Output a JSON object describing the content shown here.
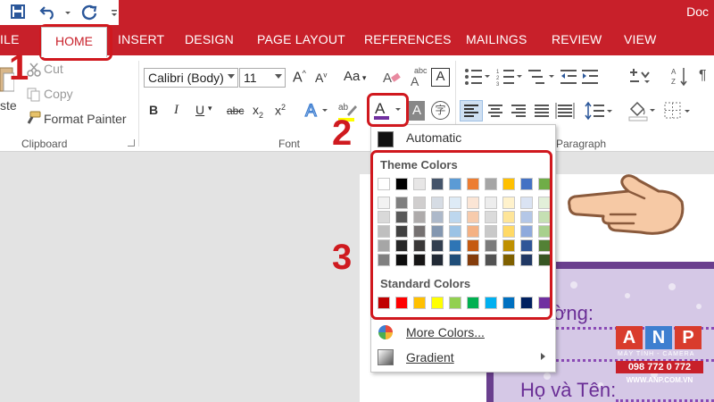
{
  "app": {
    "title": "Doc"
  },
  "qat": {
    "save_icon": "save-icon",
    "undo_icon": "undo-icon",
    "redo_icon": "redo-icon"
  },
  "tabs": {
    "file": "ILE",
    "home": "HOME",
    "insert": "INSERT",
    "design": "DESIGN",
    "page_layout": "PAGE LAYOUT",
    "references": "REFERENCES",
    "mailings": "MAILINGS",
    "review": "REVIEW",
    "view": "VIEW"
  },
  "clipboard": {
    "cut": "Cut",
    "copy": "Copy",
    "paste_fragment": "ste",
    "format_painter": "Format Painter",
    "group_label": "Clipboard"
  },
  "font": {
    "name": "Calibri (Body)",
    "size": "11",
    "case_label": "Aa",
    "group_label": "Font"
  },
  "paragraph": {
    "group_label": "Paragraph"
  },
  "menu": {
    "automatic": "Automatic",
    "theme_header": "Theme Colors",
    "standard_header": "Standard Colors",
    "more_colors": "More Colors...",
    "gradient": "Gradient"
  },
  "theme_colors": {
    "top": [
      "#ffffff",
      "#000000",
      "#e7e6e6",
      "#44546a",
      "#5b9bd5",
      "#ed7d31",
      "#a5a5a5",
      "#ffc000",
      "#4472c4",
      "#70ad47"
    ],
    "shades": [
      [
        "#f2f2f2",
        "#d9d9d9",
        "#bfbfbf",
        "#a6a6a6",
        "#808080"
      ],
      [
        "#7f7f7f",
        "#595959",
        "#404040",
        "#262626",
        "#0d0d0d"
      ],
      [
        "#d0cece",
        "#aeabab",
        "#757171",
        "#3a3838",
        "#171616"
      ],
      [
        "#d6dce4",
        "#adb9ca",
        "#8497b0",
        "#333f50",
        "#222a35"
      ],
      [
        "#deebf6",
        "#bdd7ee",
        "#9cc3e5",
        "#2e75b5",
        "#1f4e79"
      ],
      [
        "#fbe5d5",
        "#f7cbac",
        "#f4b183",
        "#c55a11",
        "#843c0b"
      ],
      [
        "#ededed",
        "#dbdbdb",
        "#c9c9c9",
        "#7b7b7b",
        "#525252"
      ],
      [
        "#fff2cc",
        "#fee599",
        "#ffd966",
        "#bf9000",
        "#7f6000"
      ],
      [
        "#dae3f3",
        "#b4c7e7",
        "#8faadc",
        "#2f5597",
        "#203864"
      ],
      [
        "#e2efd9",
        "#c5e0b3",
        "#a8d08d",
        "#538135",
        "#375623"
      ]
    ]
  },
  "standard_colors": [
    "#c00000",
    "#ff0000",
    "#ffc000",
    "#ffff00",
    "#92d050",
    "#00b050",
    "#00b0f0",
    "#0070c0",
    "#002060",
    "#7030a0"
  ],
  "callouts": {
    "one": "1",
    "two": "2",
    "three": "3"
  },
  "document": {
    "line1": "ờng:",
    "line2": "Họ và Tên:"
  },
  "watermark": {
    "a": "A",
    "n": "N",
    "p": "P",
    "tagline": "MÁY TÍNH - CAMERA",
    "phone": "098 772 0 772",
    "site": "WWW.ANP.COM.VN"
  }
}
